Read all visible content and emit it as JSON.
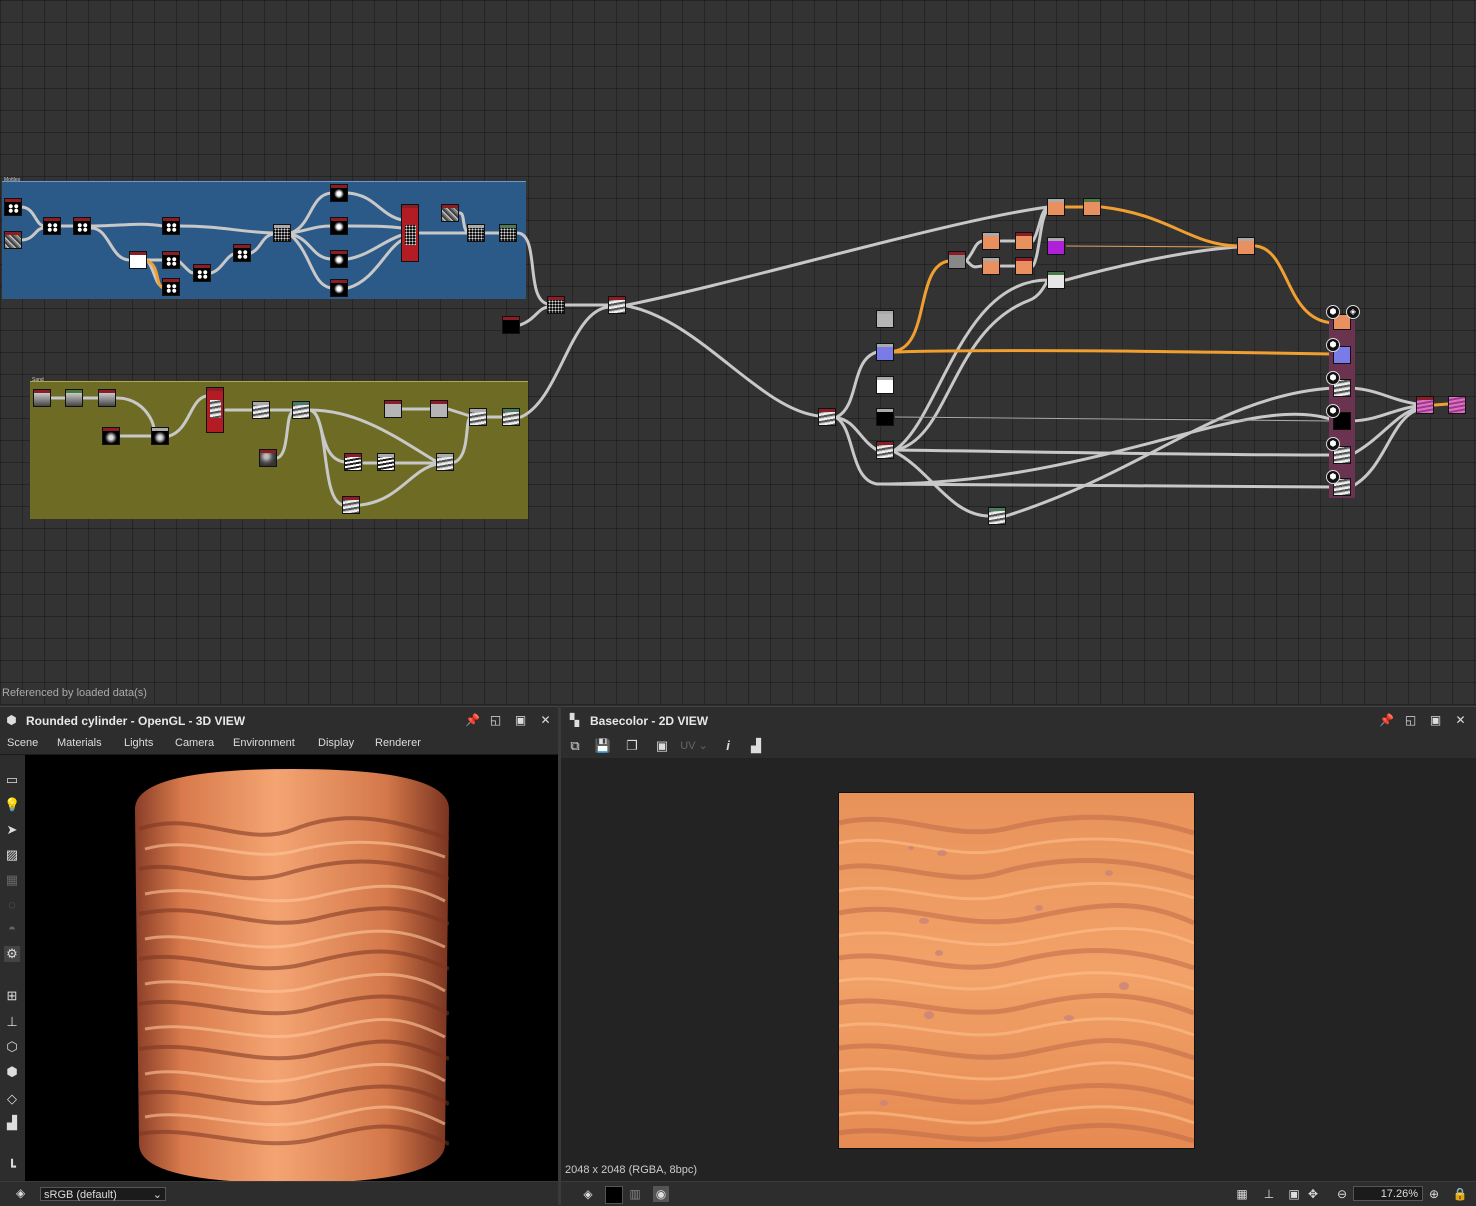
{
  "graph": {
    "status_text": "Referenced by loaded data(s)",
    "frame_titles": [
      "Mottles",
      "Sand"
    ]
  },
  "view3d": {
    "title": "Rounded cylinder - OpenGL - 3D VIEW",
    "menu": [
      "Scene",
      "Materials",
      "Lights",
      "Camera",
      "Environment",
      "Display",
      "Renderer"
    ],
    "colorspace": "sRGB (default)",
    "tool_icons": [
      "camera-icon",
      "light-icon",
      "select-icon",
      "environment-icon",
      "grid-icon",
      "shadow-icon",
      "sphere-icon",
      "settings-icon",
      "wireframe-icon",
      "axis-icon",
      "cube-icon",
      "cube-wire-icon",
      "layers-icon",
      "histogram-icon",
      "hierarchy-icon"
    ]
  },
  "view2d": {
    "title": "Basecolor - 2D VIEW",
    "uv_label": "UV",
    "resolution_info": "2048 x 2048 (RGBA, 8bpc)",
    "zoom": "17.26%"
  },
  "colors": {
    "accent_orange": "#f0a030",
    "wire": "#c8c8c8",
    "frame_blue": "#2c5a88",
    "frame_olive": "#6e6b24",
    "texture_base": "#e58a52"
  }
}
